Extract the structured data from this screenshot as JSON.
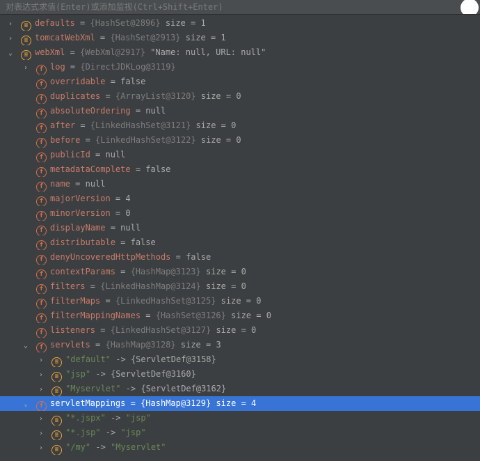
{
  "header": {
    "hint": "对表达式求值(Enter)或添加监视(Ctrl+Shift+Enter)"
  },
  "rows": [
    {
      "d": 0,
      "a": "r",
      "i": "c",
      "name": "defaults",
      "eq": " = ",
      "ref": "{HashSet@2896}",
      "sz": "  size = 1"
    },
    {
      "d": 0,
      "a": "r",
      "i": "c",
      "name": "tomcatWebXml",
      "eq": " = ",
      "ref": "{HashSet@2913}",
      "sz": "  size = 1"
    },
    {
      "d": 0,
      "a": "d",
      "i": "c",
      "name": "webXml",
      "eq": " = ",
      "ref": "{WebXml@2917}",
      "str": " \"Name: null, URL: null\""
    },
    {
      "d": 1,
      "a": "r",
      "i": "f",
      "name": "log",
      "eq": " = ",
      "ref": "{DirectJDKLog@3119}"
    },
    {
      "d": 1,
      "a": "n",
      "i": "f",
      "name": "overridable",
      "eq": " = ",
      "lit": "false"
    },
    {
      "d": 1,
      "a": "n",
      "i": "f",
      "name": "duplicates",
      "eq": " = ",
      "ref": "{ArrayList@3120}",
      "sz": "  size = 0"
    },
    {
      "d": 1,
      "a": "n",
      "i": "f",
      "name": "absoluteOrdering",
      "eq": " = ",
      "lit": "null"
    },
    {
      "d": 1,
      "a": "n",
      "i": "f",
      "name": "after",
      "eq": " = ",
      "ref": "{LinkedHashSet@3121}",
      "sz": "  size = 0"
    },
    {
      "d": 1,
      "a": "n",
      "i": "f",
      "name": "before",
      "eq": " = ",
      "ref": "{LinkedHashSet@3122}",
      "sz": "  size = 0"
    },
    {
      "d": 1,
      "a": "n",
      "i": "f",
      "name": "publicId",
      "eq": " = ",
      "lit": "null"
    },
    {
      "d": 1,
      "a": "n",
      "i": "f",
      "name": "metadataComplete",
      "eq": " = ",
      "lit": "false"
    },
    {
      "d": 1,
      "a": "n",
      "i": "f",
      "name": "name",
      "eq": " = ",
      "lit": "null"
    },
    {
      "d": 1,
      "a": "n",
      "i": "f",
      "name": "majorVersion",
      "eq": " = ",
      "lit": "4"
    },
    {
      "d": 1,
      "a": "n",
      "i": "f",
      "name": "minorVersion",
      "eq": " = ",
      "lit": "0"
    },
    {
      "d": 1,
      "a": "n",
      "i": "f",
      "name": "displayName",
      "eq": " = ",
      "lit": "null"
    },
    {
      "d": 1,
      "a": "n",
      "i": "f",
      "name": "distributable",
      "eq": " = ",
      "lit": "false"
    },
    {
      "d": 1,
      "a": "n",
      "i": "f",
      "name": "denyUncoveredHttpMethods",
      "eq": " = ",
      "lit": "false"
    },
    {
      "d": 1,
      "a": "n",
      "i": "f",
      "name": "contextParams",
      "eq": " = ",
      "ref": "{HashMap@3123}",
      "sz": "  size = 0"
    },
    {
      "d": 1,
      "a": "n",
      "i": "f",
      "name": "filters",
      "eq": " = ",
      "ref": "{LinkedHashMap@3124}",
      "sz": "  size = 0"
    },
    {
      "d": 1,
      "a": "n",
      "i": "f",
      "name": "filterMaps",
      "eq": " = ",
      "ref": "{LinkedHashSet@3125}",
      "sz": "  size = 0"
    },
    {
      "d": 1,
      "a": "n",
      "i": "f",
      "name": "filterMappingNames",
      "eq": " = ",
      "ref": "{HashSet@3126}",
      "sz": "  size = 0"
    },
    {
      "d": 1,
      "a": "n",
      "i": "f",
      "name": "listeners",
      "eq": " = ",
      "ref": "{LinkedHashSet@3127}",
      "sz": "  size = 0"
    },
    {
      "d": 1,
      "a": "d",
      "i": "f",
      "name": "servlets",
      "eq": " = ",
      "ref": "{HashMap@3128}",
      "sz": "  size = 3"
    },
    {
      "d": 2,
      "a": "r",
      "i": "c",
      "kv": "\"default\" -> {ServletDef@3158}"
    },
    {
      "d": 2,
      "a": "r",
      "i": "c",
      "kv": "\"jsp\" -> {ServletDef@3160}"
    },
    {
      "d": 2,
      "a": "r",
      "i": "c",
      "kv": "\"Myservlet\" -> {ServletDef@3162}"
    },
    {
      "d": 1,
      "a": "d",
      "i": "f",
      "name": "servletMappings",
      "eq": " = ",
      "ref": "{HashMap@3129}",
      "sz": "  size = 4",
      "sel": true
    },
    {
      "d": 2,
      "a": "r",
      "i": "c",
      "kv": "\"*.jspx\" -> \"jsp\""
    },
    {
      "d": 2,
      "a": "r",
      "i": "c",
      "kv": "\"*.jsp\" -> \"jsp\""
    },
    {
      "d": 2,
      "a": "r",
      "i": "c",
      "kv": "\"/my\" -> \"Myservlet\""
    }
  ]
}
